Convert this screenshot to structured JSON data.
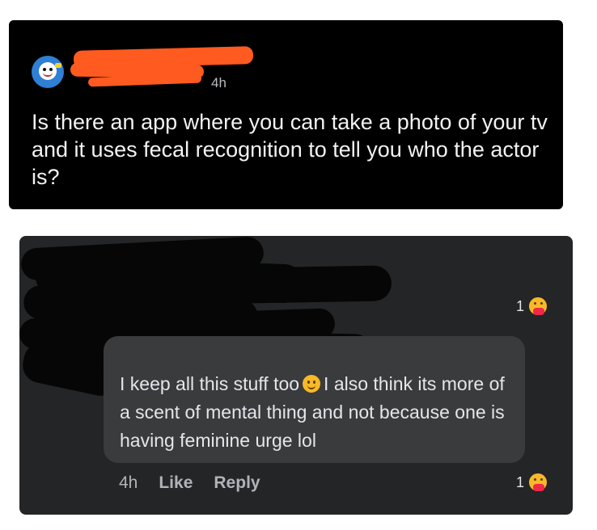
{
  "post": {
    "author_redacted": true,
    "time": "4h",
    "text": "Is there an app where you can take a photo of your tv and it uses fecal recognition to tell you who the actor is?"
  },
  "comment": {
    "top_reaction_count": "1",
    "text_part1": "I keep all this stuff too",
    "text_part2": "I also think its more of a scent of mental thing and not because one is having feminine urge lol",
    "time": "4h",
    "like_label": "Like",
    "reply_label": "Reply",
    "reaction_count": "1"
  },
  "icons": {
    "avatar": "avatar-icon",
    "reaction": "care-reaction-icon",
    "inline_emoji": "slightly-smiling-face-icon"
  },
  "colors": {
    "post_bg": "#000000",
    "comment_bg": "#242526",
    "bubble_bg": "#3a3b3c",
    "redaction": "#ff5a1f",
    "reaction_yellow": "#f7b928"
  }
}
